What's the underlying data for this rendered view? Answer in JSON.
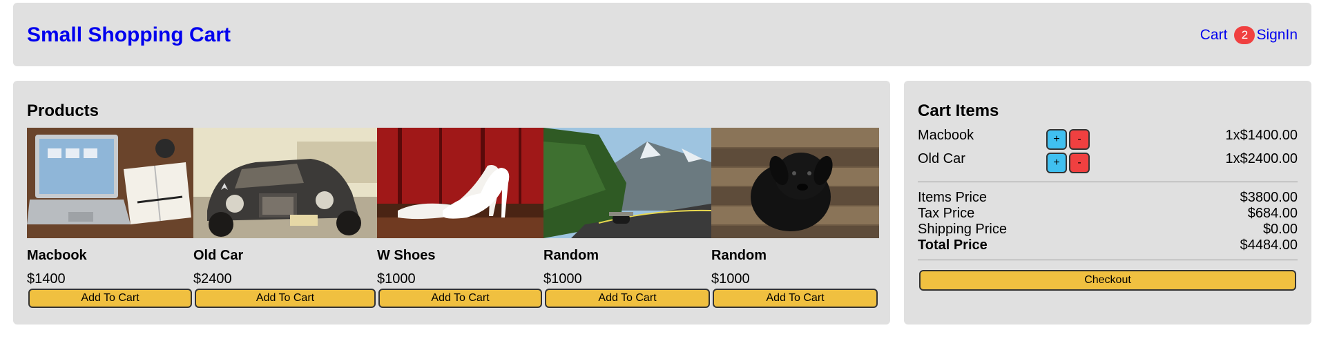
{
  "header": {
    "brand": "Small Shopping Cart",
    "cart_label": "Cart",
    "cart_count": "2",
    "signin_label": "SignIn"
  },
  "products": {
    "title": "Products",
    "add_label": "Add To Cart",
    "items": [
      {
        "name": "Macbook",
        "price": "$1400",
        "image": "laptop-photo"
      },
      {
        "name": "Old Car",
        "price": "$2400",
        "image": "vintage-car-photo"
      },
      {
        "name": "W Shoes",
        "price": "$1000",
        "image": "white-heels-photo"
      },
      {
        "name": "Random",
        "price": "$1000",
        "image": "mountain-road-photo"
      },
      {
        "name": "Random",
        "price": "$1000",
        "image": "black-puppy-photo"
      }
    ]
  },
  "cart": {
    "title": "Cart Items",
    "plus_label": "+",
    "minus_label": "-",
    "items": [
      {
        "name": "Macbook",
        "qty_price": "1x$1400.00"
      },
      {
        "name": "Old Car",
        "qty_price": "1x$2400.00"
      }
    ],
    "summary": {
      "items_label": "Items Price",
      "items_value": "$3800.00",
      "tax_label": "Tax Price",
      "tax_value": "$684.00",
      "shipping_label": "Shipping Price",
      "shipping_value": "$0.00",
      "total_label": "Total Price",
      "total_value": "$4484.00"
    },
    "checkout_label": "Checkout"
  },
  "colors": {
    "link": "#0000ee",
    "panel": "#e0e0e0",
    "button_yellow": "#f0c040",
    "badge_red": "#f04040",
    "plus_blue": "#40c0f0"
  }
}
